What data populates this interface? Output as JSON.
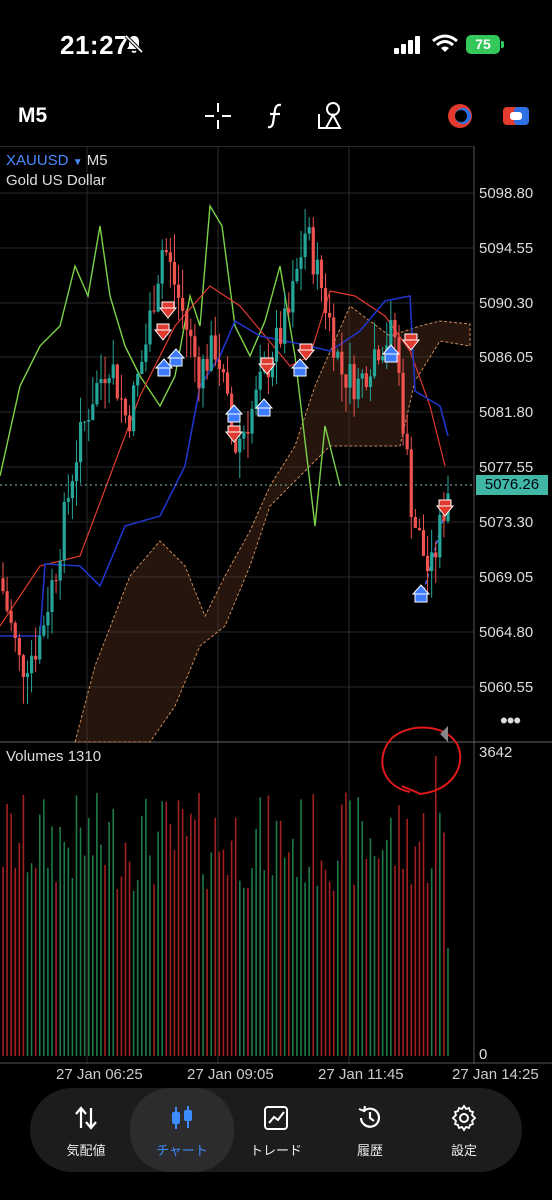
{
  "status_bar": {
    "time": "21:27",
    "battery": "75"
  },
  "toolbar": {
    "timeframe": "M5"
  },
  "chart": {
    "symbol": "XAUUSD",
    "symbol_timeframe": "M5",
    "description": "Gold US Dollar",
    "price_labels": [
      "5098.80",
      "5094.55",
      "5090.30",
      "5086.05",
      "5081.80",
      "5077.55",
      "5073.30",
      "5069.05",
      "5064.80",
      "5060.55"
    ],
    "current_price": "5076.26",
    "volumes_label": "Volumes 1310",
    "volume_max": "3642",
    "volume_min": "0",
    "x_labels": [
      "27 Jan 06:25",
      "27 Jan 09:05",
      "27 Jan 11:45",
      "27 Jan 14:25"
    ],
    "colors": {
      "up": "#26a69a",
      "down": "#ef5350",
      "annotation": "#e0191a"
    }
  },
  "chart_data": {
    "type": "line",
    "title": "",
    "xlabel": "",
    "ylabel": "",
    "x": [
      "27 Jan 06:25",
      "27 Jan 09:05",
      "27 Jan 11:45",
      "27 Jan 14:25"
    ],
    "ylim": [
      5058,
      5101
    ],
    "series": [
      {
        "values": [
          5068,
          5062,
          5064,
          5070,
          5078,
          5083,
          5086,
          5081,
          5087,
          5095,
          5090,
          5085,
          5087,
          5079,
          5082,
          5086,
          5089,
          5096,
          5091,
          5085,
          5084,
          5087,
          5088,
          5074,
          5069,
          5076
        ]
      }
    ],
    "volume": {
      "max": 3642,
      "latest": 1310
    }
  },
  "nav": {
    "items": [
      {
        "label": "気配値"
      },
      {
        "label": "チャート"
      },
      {
        "label": "トレード"
      },
      {
        "label": "履歴"
      },
      {
        "label": "設定"
      }
    ]
  }
}
